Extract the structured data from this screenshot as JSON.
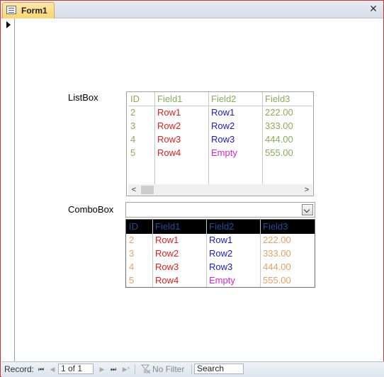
{
  "window": {
    "tab_label": "Form1",
    "close_glyph": "✕"
  },
  "listbox": {
    "label": "ListBox",
    "columns": [
      "ID",
      "Field1",
      "Field2",
      "Field3"
    ],
    "rows": [
      [
        "2",
        "Row1",
        "Row1",
        "222.00"
      ],
      [
        "3",
        "Row2",
        "Row2",
        "333.00"
      ],
      [
        "4",
        "Row3",
        "Row3",
        "444.00"
      ],
      [
        "5",
        "Row4",
        "Empty",
        "555.00"
      ]
    ],
    "scroll_left_glyph": "<",
    "scroll_right_glyph": ">"
  },
  "combobox": {
    "label": "ComboBox",
    "value": "",
    "columns": [
      "ID",
      "Field1",
      "Field2",
      "Field3"
    ],
    "rows": [
      [
        "2",
        "Row1",
        "Row1",
        "222.00"
      ],
      [
        "3",
        "Row2",
        "Row2",
        "333.00"
      ],
      [
        "4",
        "Row3",
        "Row3",
        "444.00"
      ],
      [
        "5",
        "Row4",
        "Empty",
        "555.00"
      ]
    ]
  },
  "colors": {
    "listbox_id": "#8aac5a",
    "listbox_field1": "#e0201c",
    "listbox_field2": "#1a1acc",
    "listbox_field2_empty": "#e020e0",
    "listbox_field3": "#8aac5a",
    "listbox_header": "#8aac5a",
    "combo_header_text": "#1c4f9c",
    "combo_id": "#e8a060",
    "combo_field1": "#e0201c",
    "combo_field2": "#1a1acc",
    "combo_field2_empty": "#e020e0",
    "combo_field3": "#e8a060"
  },
  "navigation": {
    "record_label": "Record:",
    "record_position": "1 of 1",
    "filter_label": "No Filter",
    "search_value": "Search",
    "first_glyph": "⏮",
    "prev_glyph": "◀",
    "next_glyph": "▶",
    "last_glyph": "⏭",
    "new_glyph": "▶*"
  }
}
